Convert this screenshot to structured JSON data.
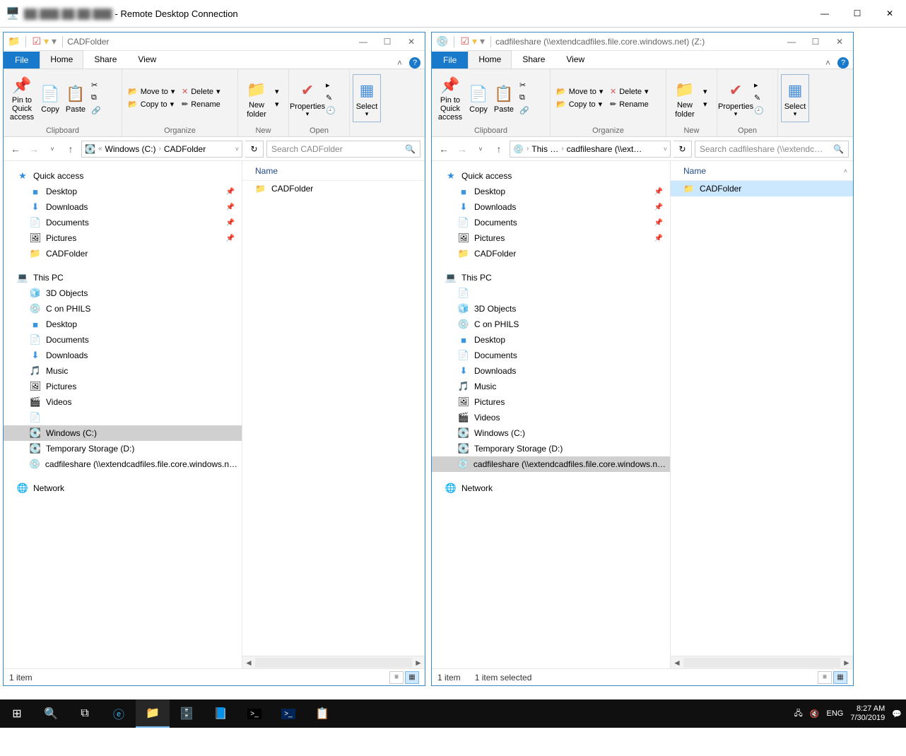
{
  "rdc": {
    "title_suffix": " - Remote Desktop Connection",
    "ip_masked": "██.███.██.██:███"
  },
  "left": {
    "title": "CADFolder",
    "tabs": {
      "file": "File",
      "home": "Home",
      "share": "Share",
      "view": "View"
    },
    "ribbon": {
      "pin": "Pin to Quick\naccess",
      "copy": "Copy",
      "paste": "Paste",
      "move": "Move to",
      "copyto": "Copy to",
      "delete": "Delete",
      "rename": "Rename",
      "newf": "New\nfolder",
      "props": "Properties",
      "select": "Select",
      "g_clip": "Clipboard",
      "g_org": "Organize",
      "g_new": "New",
      "g_open": "Open"
    },
    "crumbs": [
      "Windows (C:)",
      "CADFolder"
    ],
    "search_ph": "Search CADFolder",
    "col_name": "Name",
    "files": [
      {
        "name": "CADFolder",
        "selected": false
      }
    ],
    "nav": {
      "quick": "Quick access",
      "q": [
        "Desktop",
        "Downloads",
        "Documents",
        "Pictures",
        "CADFolder"
      ],
      "thispc": "This PC",
      "pc": [
        "3D Objects",
        "C on PHILS",
        "Desktop",
        "Documents",
        "Downloads",
        "Music",
        "Pictures",
        "Videos",
        "",
        "Windows (C:)",
        "Temporary Storage (D:)",
        "cadfileshare (\\\\extendcadfiles.file.core.windows.net) (Z:)"
      ],
      "pc_selected": "Windows (C:)",
      "network": "Network"
    },
    "status": {
      "count": "1 item"
    }
  },
  "right": {
    "title": "cadfileshare (\\\\extendcadfiles.file.core.windows.net) (Z:)",
    "tabs": {
      "file": "File",
      "home": "Home",
      "share": "Share",
      "view": "View"
    },
    "ribbon": {
      "pin": "Pin to Quick\naccess",
      "copy": "Copy",
      "paste": "Paste",
      "move": "Move to",
      "copyto": "Copy to",
      "delete": "Delete",
      "rename": "Rename",
      "newf": "New\nfolder",
      "props": "Properties",
      "select": "Select",
      "g_clip": "Clipboard",
      "g_org": "Organize",
      "g_new": "New",
      "g_open": "Open"
    },
    "crumbs": [
      "This …",
      "cadfileshare (\\\\ext…"
    ],
    "search_ph": "Search cadfileshare (\\\\extendcadfile…",
    "col_name": "Name",
    "files": [
      {
        "name": "CADFolder",
        "selected": true
      }
    ],
    "nav": {
      "quick": "Quick access",
      "q": [
        "Desktop",
        "Downloads",
        "Documents",
        "Pictures",
        "CADFolder"
      ],
      "thispc": "This PC",
      "pc": [
        "",
        "3D Objects",
        "C on PHILS",
        "Desktop",
        "Documents",
        "Downloads",
        "Music",
        "Pictures",
        "Videos",
        "Windows (C:)",
        "Temporary Storage (D:)",
        "cadfileshare (\\\\extendcadfiles.file.core.windows.net) (Z:)"
      ],
      "pc_selected": "cadfileshare (\\\\extendcadfiles.file.core.windows.net) (Z:)",
      "network": "Network"
    },
    "status": {
      "count": "1 item",
      "sel": "1 item selected"
    }
  },
  "tray": {
    "lang": "ENG",
    "time": "8:27 AM",
    "date": "7/30/2019"
  }
}
